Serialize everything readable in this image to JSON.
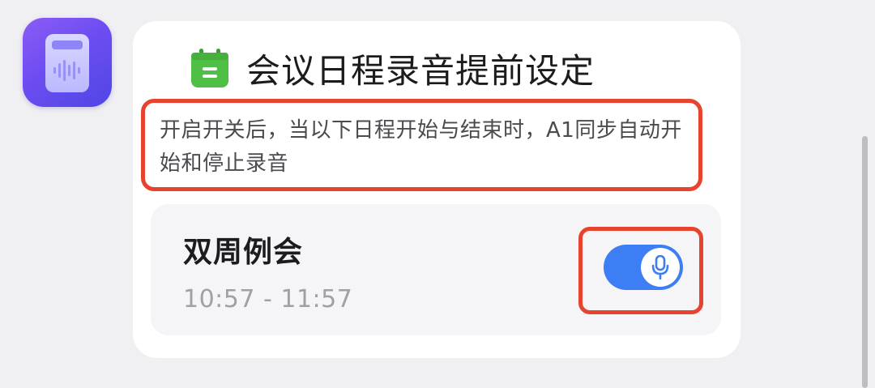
{
  "app": {
    "icon_name": "voice-recorder-icon",
    "gradient_start": "#8b5cf6",
    "gradient_end": "#4f46e5"
  },
  "card": {
    "title": "会议日程录音提前设定",
    "title_icon": "calendar-icon",
    "description": "开启开关后，当以下日程开始与结束时，A1同步自动开始和停止录音"
  },
  "event": {
    "name": "双周例会",
    "time": "10:57 - 11:57",
    "toggle": {
      "state": "on",
      "icon": "microphone-icon",
      "color": "#3d7ef5"
    }
  },
  "highlight": {
    "color": "#e8432e"
  }
}
